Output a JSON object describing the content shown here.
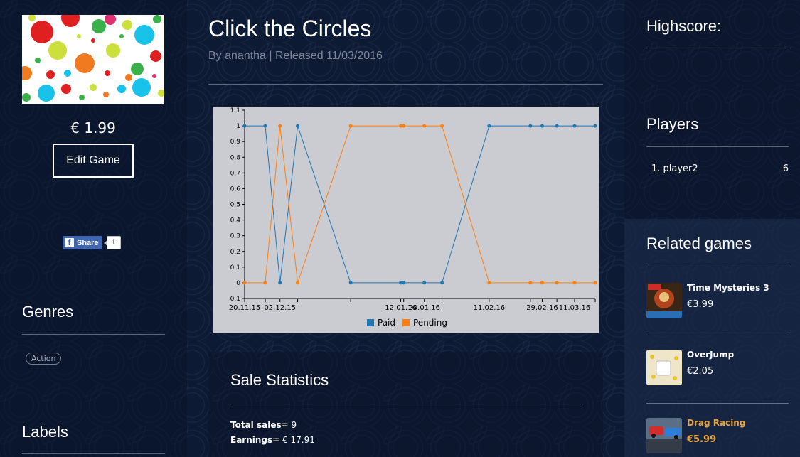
{
  "game": {
    "title": "Click the Circles",
    "byline": "By anantha | Released 11/03/2016",
    "price": "€ 1.99",
    "edit_label": "Edit Game"
  },
  "share": {
    "label": "Share",
    "count": "1",
    "icon": "facebook-icon"
  },
  "left": {
    "genres_heading": "Genres",
    "genre_tag": "Action",
    "labels_heading": "Labels"
  },
  "chart_data": {
    "type": "line",
    "x": [
      "20.11.15",
      "27.11.15",
      "02.12.15",
      "08.12.15",
      "26.12.15",
      "12.01.16",
      "13.01.16",
      "20.01.16",
      "26.01.16",
      "11.02.16",
      "25.02.16",
      "29.02.16",
      "05.03.16",
      "11.03.16",
      "18.03.16"
    ],
    "xtick_labels": [
      "20.11.15",
      "02.12.15",
      "12.01.16",
      "20.01.16",
      "11.02.16",
      "29.02.16",
      "11.03.16"
    ],
    "series": [
      {
        "name": "Paid",
        "color": "#1f77b4",
        "values": [
          1,
          1,
          0,
          1,
          0,
          0,
          0,
          0,
          0,
          1,
          1,
          1,
          1,
          1,
          1
        ]
      },
      {
        "name": "Pending",
        "color": "#ff7f0e",
        "values": [
          0,
          0,
          1,
          0,
          1,
          1,
          1,
          1,
          1,
          0,
          0,
          0,
          0,
          0,
          0
        ]
      }
    ],
    "ylim": [
      -0.1,
      1.1
    ],
    "yticks": [
      "1.1",
      "1",
      "0.9",
      "0.8",
      "0.7",
      "0.6",
      "0.5",
      "0.4",
      "0.3",
      "0.2",
      "0.1",
      "0",
      "-0.1"
    ],
    "legend": "bottom",
    "grid": false
  },
  "stats": {
    "heading": "Sale Statistics",
    "total_label": "Total sales=",
    "total_value": "9",
    "earnings_label": "Earnings=",
    "earnings_value": "€ 17.91"
  },
  "right": {
    "highscore_heading": "Highscore:",
    "players_heading": "Players",
    "players": [
      {
        "rank_name": "1. player2",
        "score": "6"
      }
    ],
    "related_heading": "Related games",
    "related": [
      {
        "name": "Time Mysteries 3",
        "price": "€3.99",
        "highlight": false
      },
      {
        "name": "OverJump",
        "price": "€2.05",
        "highlight": false
      },
      {
        "name": "Drag Racing",
        "price": "€5.99",
        "highlight": true
      }
    ]
  },
  "colors": {
    "highlight": "#e8a43a",
    "chart_bg": "#cbcbd2",
    "paid": "#1f77b4",
    "pending": "#ff7f0e"
  }
}
